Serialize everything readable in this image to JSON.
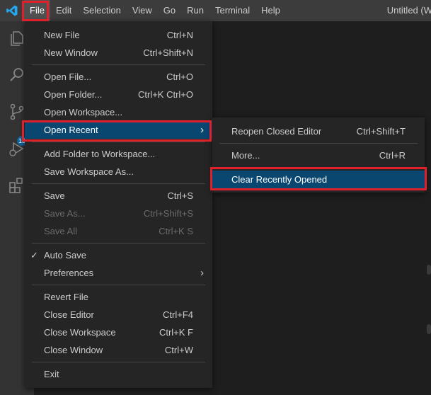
{
  "menubar": {
    "items": [
      "File",
      "Edit",
      "Selection",
      "View",
      "Go",
      "Run",
      "Terminal",
      "Help"
    ],
    "active_index": 0
  },
  "window_title": "Untitled (W",
  "activitybar": {
    "icons": [
      "explorer-icon",
      "search-icon",
      "source-control-icon",
      "run-debug-icon",
      "extensions-icon"
    ],
    "scm_badge": "13"
  },
  "file_menu": {
    "items": [
      {
        "label": "New File",
        "shortcut": "Ctrl+N"
      },
      {
        "label": "New Window",
        "shortcut": "Ctrl+Shift+N"
      },
      {
        "label": "Open File...",
        "shortcut": "Ctrl+O"
      },
      {
        "label": "Open Folder...",
        "shortcut": "Ctrl+K Ctrl+O"
      },
      {
        "label": "Open Workspace...",
        "shortcut": ""
      },
      {
        "label": "Open Recent",
        "shortcut": ""
      },
      {
        "label": "Add Folder to Workspace...",
        "shortcut": ""
      },
      {
        "label": "Save Workspace As...",
        "shortcut": ""
      },
      {
        "label": "Save",
        "shortcut": "Ctrl+S"
      },
      {
        "label": "Save As...",
        "shortcut": "Ctrl+Shift+S"
      },
      {
        "label": "Save All",
        "shortcut": "Ctrl+K S"
      },
      {
        "label": "Auto Save",
        "shortcut": "",
        "check": "✓"
      },
      {
        "label": "Preferences",
        "shortcut": ""
      },
      {
        "label": "Revert File",
        "shortcut": ""
      },
      {
        "label": "Close Editor",
        "shortcut": "Ctrl+F4"
      },
      {
        "label": "Close Workspace",
        "shortcut": "Ctrl+K F"
      },
      {
        "label": "Close Window",
        "shortcut": "Ctrl+W"
      },
      {
        "label": "Exit",
        "shortcut": ""
      }
    ]
  },
  "recent_menu": {
    "items": [
      {
        "label": "Reopen Closed Editor",
        "shortcut": "Ctrl+Shift+T"
      },
      {
        "label": "More...",
        "shortcut": "Ctrl+R"
      },
      {
        "label": "Clear Recently Opened",
        "shortcut": ""
      }
    ]
  },
  "colors": {
    "highlight_box": "#e0202a",
    "selection": "#094771",
    "menu_bg": "#252526",
    "titlebar_bg": "#3c3c3c",
    "activitybar_bg": "#333333",
    "editor_bg": "#1e1e1e",
    "logo_blue": "#23a9f2"
  }
}
